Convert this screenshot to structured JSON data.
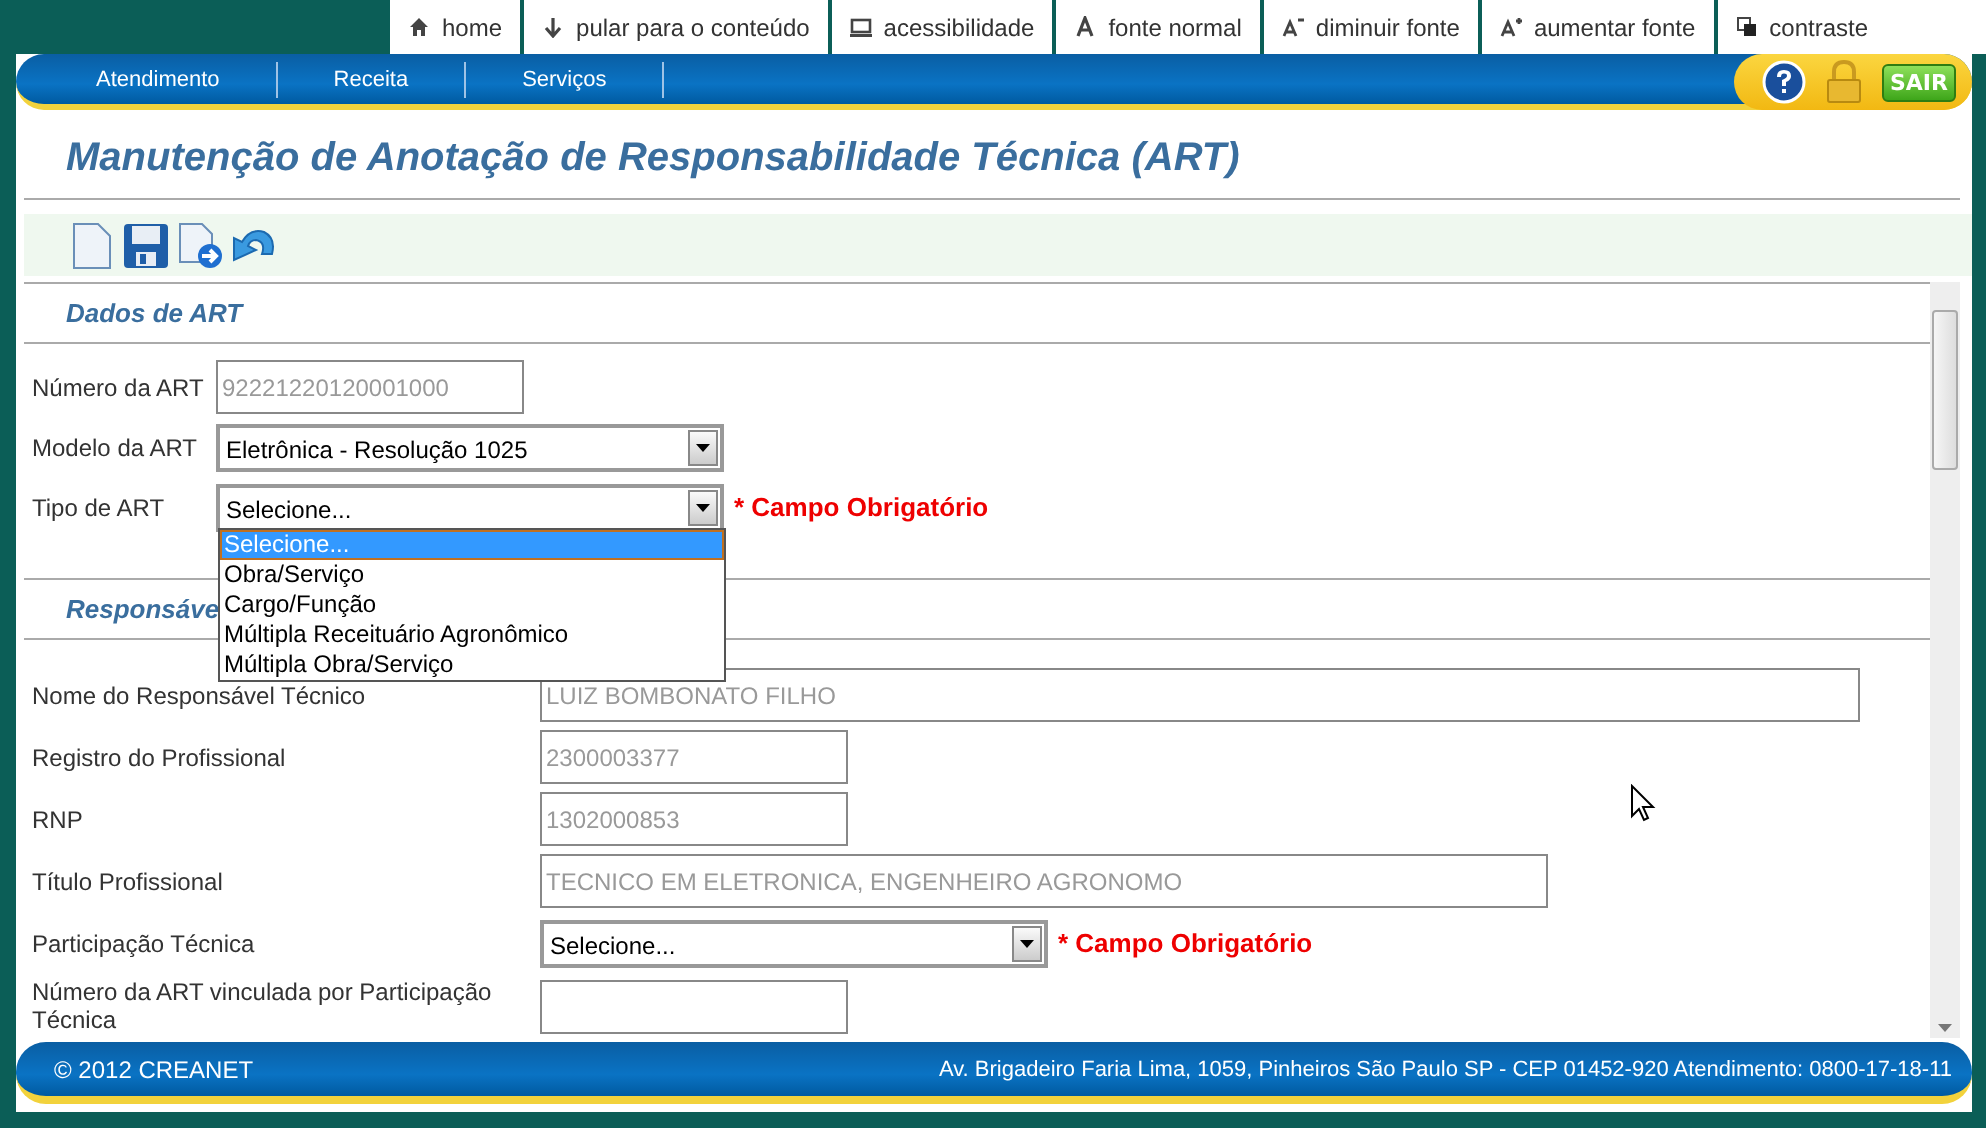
{
  "top_links": [
    {
      "label": "home",
      "kind": "home"
    },
    {
      "label": "pular para o conteúdo",
      "kind": "skip"
    },
    {
      "label": "acessibilidade",
      "kind": "access"
    },
    {
      "label": "fonte normal",
      "kind": "font"
    },
    {
      "label": "diminuir fonte",
      "kind": "smaller"
    },
    {
      "label": "aumentar fonte",
      "kind": "larger"
    },
    {
      "label": "contraste",
      "kind": "contrast"
    }
  ],
  "nav": {
    "items": [
      "Atendimento",
      "Receita",
      "Serviços"
    ],
    "logout": "SAIR"
  },
  "title": "Manutenção de Anotação de Responsabilidade Técnica (ART)",
  "sections": [
    {
      "heading": "Dados de ART",
      "fields": [
        {
          "label": "Número da ART",
          "kind": "text",
          "value": "92221220120001000",
          "readonly": true
        },
        {
          "label": "Modelo da ART",
          "kind": "select",
          "value": "Eletrônica - Resolução 1025"
        },
        {
          "label": "Tipo de ART",
          "kind": "select",
          "value": "Selecione...",
          "required_note": "* Campo Obrigatório",
          "open": true,
          "options": [
            {
              "label": "Selecione...",
              "selected": true
            },
            {
              "label": "Obra/Serviço",
              "selected": false
            },
            {
              "label": "Cargo/Função",
              "selected": false
            },
            {
              "label": "Múltipla Receituário Agronômico",
              "selected": false
            },
            {
              "label": "Múltipla Obra/Serviço",
              "selected": false
            }
          ]
        }
      ]
    },
    {
      "heading": "Responsáve",
      "fields": [
        {
          "label": "Nome do Responsável Técnico",
          "kind": "text",
          "value": "LUIZ BOMBONATO FILHO",
          "readonly": true
        },
        {
          "label": "Registro do Profissional",
          "kind": "text",
          "value": "2300003377",
          "readonly": true
        },
        {
          "label": "RNP",
          "kind": "text",
          "value": "1302000853",
          "readonly": true
        },
        {
          "label": "Título Profissional",
          "kind": "text",
          "value": "TECNICO EM ELETRONICA, ENGENHEIRO AGRONOMO",
          "readonly": true
        },
        {
          "label": "Participação Técnica",
          "kind": "select",
          "value": "Selecione...",
          "required_note": "* Campo Obrigatório"
        },
        {
          "label": "Número da ART vinculada por Participação Técnica",
          "kind": "text"
        }
      ]
    }
  ],
  "footer": {
    "copyright": "© 2012 CREANET",
    "address": "Av. Brigadeiro Faria Lima, 1059, Pinheiros São Paulo SP - CEP 01452-920 Atendimento: 0800-17-18-11"
  }
}
